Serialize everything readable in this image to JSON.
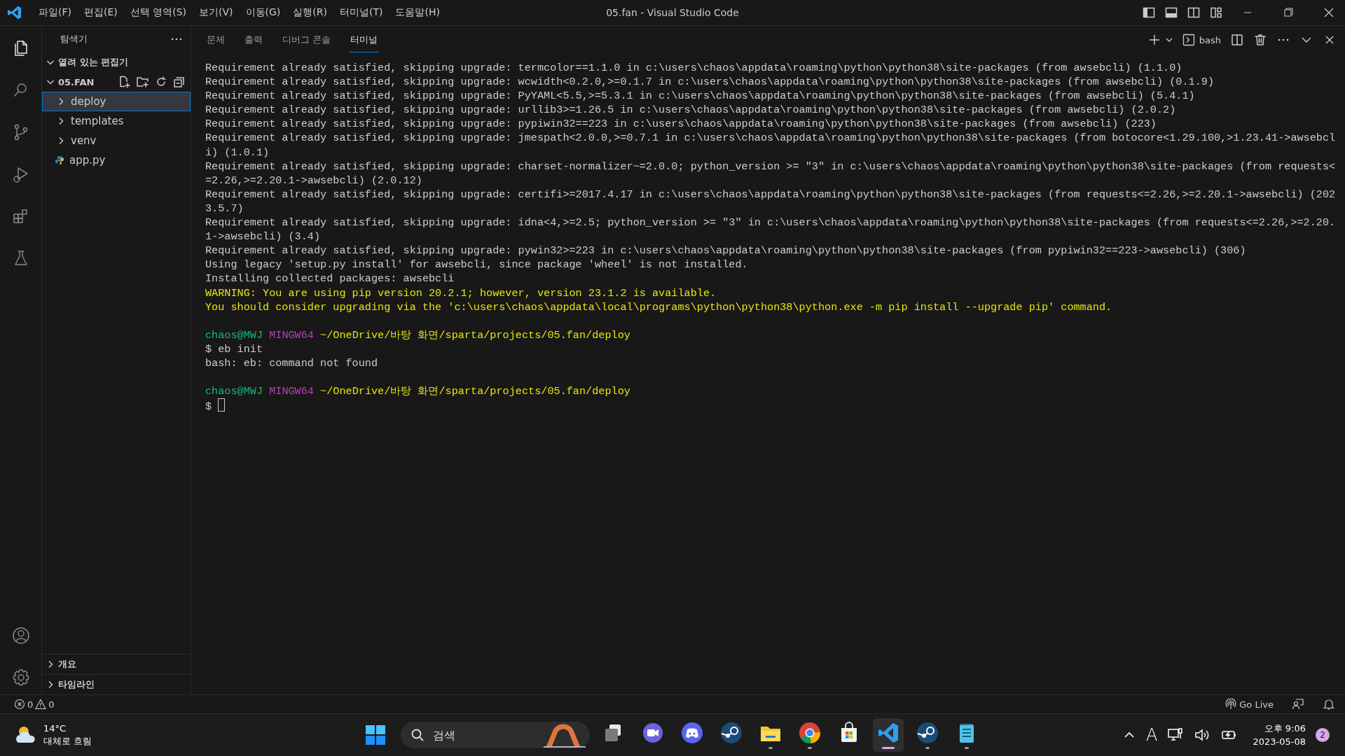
{
  "window": {
    "title": "05.fan - Visual Studio Code"
  },
  "menu": [
    "파일(F)",
    "편집(E)",
    "선택 영역(S)",
    "보기(V)",
    "이동(G)",
    "실행(R)",
    "터미널(T)",
    "도움말(H)"
  ],
  "activity_bar": [
    {
      "kind": "explorer",
      "selected": true
    },
    {
      "kind": "search",
      "selected": false
    },
    {
      "kind": "source-control",
      "selected": false
    },
    {
      "kind": "run-debug",
      "selected": false
    },
    {
      "kind": "extensions",
      "selected": false
    },
    {
      "kind": "testing",
      "selected": false
    }
  ],
  "sidebar": {
    "title": "탐색기",
    "sections": [
      {
        "label": "열려 있는 편집기",
        "expanded": true
      },
      {
        "label": "05.FAN",
        "expanded": true
      }
    ],
    "tree": [
      {
        "label": "deploy",
        "kind": "folder",
        "expanded": false,
        "selected": true
      },
      {
        "label": "templates",
        "kind": "folder",
        "expanded": false,
        "selected": false
      },
      {
        "label": "venv",
        "kind": "folder",
        "expanded": false,
        "selected": false
      },
      {
        "label": "app.py",
        "kind": "python",
        "selected": false
      }
    ],
    "bottom_sections": [
      {
        "label": "개요",
        "expanded": false
      },
      {
        "label": "타임라인",
        "expanded": false
      }
    ]
  },
  "panel": {
    "tabs": [
      {
        "label": "문제",
        "selected": false
      },
      {
        "label": "출력",
        "selected": false
      },
      {
        "label": "디버그 콘솔",
        "selected": false
      },
      {
        "label": "터미널",
        "selected": true
      }
    ],
    "terminal_name": "bash",
    "lines": [
      {
        "kind": "output",
        "text": "Requirement already satisfied, skipping upgrade: termcolor==1.1.0 in c:\\users\\chaos\\appdata\\roaming\\python\\python38\\site-packages (from awsebcli) (1.1.0)"
      },
      {
        "kind": "output",
        "text": "Requirement already satisfied, skipping upgrade: wcwidth<0.2.0,>=0.1.7 in c:\\users\\chaos\\appdata\\roaming\\python\\python38\\site-packages (from awsebcli) (0.1.9)"
      },
      {
        "kind": "output",
        "text": "Requirement already satisfied, skipping upgrade: PyYAML<5.5,>=5.3.1 in c:\\users\\chaos\\appdata\\roaming\\python\\python38\\site-packages (from awsebcli) (5.4.1)"
      },
      {
        "kind": "output",
        "text": "Requirement already satisfied, skipping upgrade: urllib3>=1.26.5 in c:\\users\\chaos\\appdata\\roaming\\python\\python38\\site-packages (from awsebcli) (2.0.2)"
      },
      {
        "kind": "output",
        "text": "Requirement already satisfied, skipping upgrade: pypiwin32==223 in c:\\users\\chaos\\appdata\\roaming\\python\\python38\\site-packages (from awsebcli) (223)"
      },
      {
        "kind": "output",
        "text": "Requirement already satisfied, skipping upgrade: jmespath<2.0.0,>=0.7.1 in c:\\users\\chaos\\appdata\\roaming\\python\\python38\\site-packages (from botocore<1.29.100,>1.23.41->awsebcl"
      },
      {
        "kind": "output",
        "text": "i) (1.0.1)"
      },
      {
        "kind": "output",
        "text": "Requirement already satisfied, skipping upgrade: charset-normalizer~=2.0.0; python_version >= \"3\" in c:\\users\\chaos\\appdata\\roaming\\python\\python38\\site-packages (from requests<"
      },
      {
        "kind": "output",
        "text": "=2.26,>=2.20.1->awsebcli) (2.0.12)"
      },
      {
        "kind": "output",
        "text": "Requirement already satisfied, skipping upgrade: certifi>=2017.4.17 in c:\\users\\chaos\\appdata\\roaming\\python\\python38\\site-packages (from requests<=2.26,>=2.20.1->awsebcli) (202"
      },
      {
        "kind": "output",
        "text": "3.5.7)"
      },
      {
        "kind": "output",
        "text": "Requirement already satisfied, skipping upgrade: idna<4,>=2.5; python_version >= \"3\" in c:\\users\\chaos\\appdata\\roaming\\python\\python38\\site-packages (from requests<=2.26,>=2.20."
      },
      {
        "kind": "output",
        "text": "1->awsebcli) (3.4)"
      },
      {
        "kind": "output",
        "text": "Requirement already satisfied, skipping upgrade: pywin32>=223 in c:\\users\\chaos\\appdata\\roaming\\python\\python38\\site-packages (from pypiwin32==223->awsebcli) (306)"
      },
      {
        "kind": "output",
        "text": "Using legacy 'setup.py install' for awsebcli, since package 'wheel' is not installed."
      },
      {
        "kind": "output",
        "text": "Installing collected packages: awsebcli"
      },
      {
        "kind": "warning",
        "text": "WARNING: You are using pip version 20.2.1; however, version 23.1.2 is available."
      },
      {
        "kind": "warning",
        "text": "You should consider upgrading via the 'c:\\users\\chaos\\appdata\\local\\programs\\python\\python38\\python.exe -m pip install --upgrade pip' command."
      },
      {
        "kind": "blank"
      },
      {
        "kind": "prompt",
        "user": "chaos@MWJ",
        "system": "MINGW64",
        "path": "~/OneDrive/바탕 화면/sparta/projects/05.fan/deploy"
      },
      {
        "kind": "output",
        "text": "$ eb init"
      },
      {
        "kind": "output",
        "text": "bash: eb: command not found"
      },
      {
        "kind": "blank"
      },
      {
        "kind": "prompt",
        "user": "chaos@MWJ",
        "system": "MINGW64",
        "path": "~/OneDrive/바탕 화면/sparta/projects/05.fan/deploy"
      },
      {
        "kind": "cursor",
        "text": "$"
      }
    ]
  },
  "status_bar": {
    "errors": "0",
    "warnings": "0",
    "go_live": "Go Live"
  },
  "taskbar": {
    "weather": {
      "temperature": "14°C",
      "condition": "대체로 흐림"
    },
    "search": {
      "placeholder": "검색"
    },
    "apps": [
      {
        "kind": "task-view",
        "running": false,
        "active": false
      },
      {
        "kind": "meet",
        "running": false,
        "active": false
      },
      {
        "kind": "discord",
        "running": false,
        "active": false
      },
      {
        "kind": "steam",
        "running": false,
        "active": false
      },
      {
        "kind": "files",
        "running": true,
        "active": false
      },
      {
        "kind": "chrome",
        "running": true,
        "active": false
      },
      {
        "kind": "store",
        "running": false,
        "active": false
      },
      {
        "kind": "vscode",
        "running": true,
        "active": true
      },
      {
        "kind": "steam",
        "running": true,
        "active": false
      },
      {
        "kind": "notepad",
        "running": true,
        "active": false
      }
    ],
    "ime": "A",
    "time": "오후 9:06",
    "date": "2023-05-08",
    "notifications": "2"
  }
}
